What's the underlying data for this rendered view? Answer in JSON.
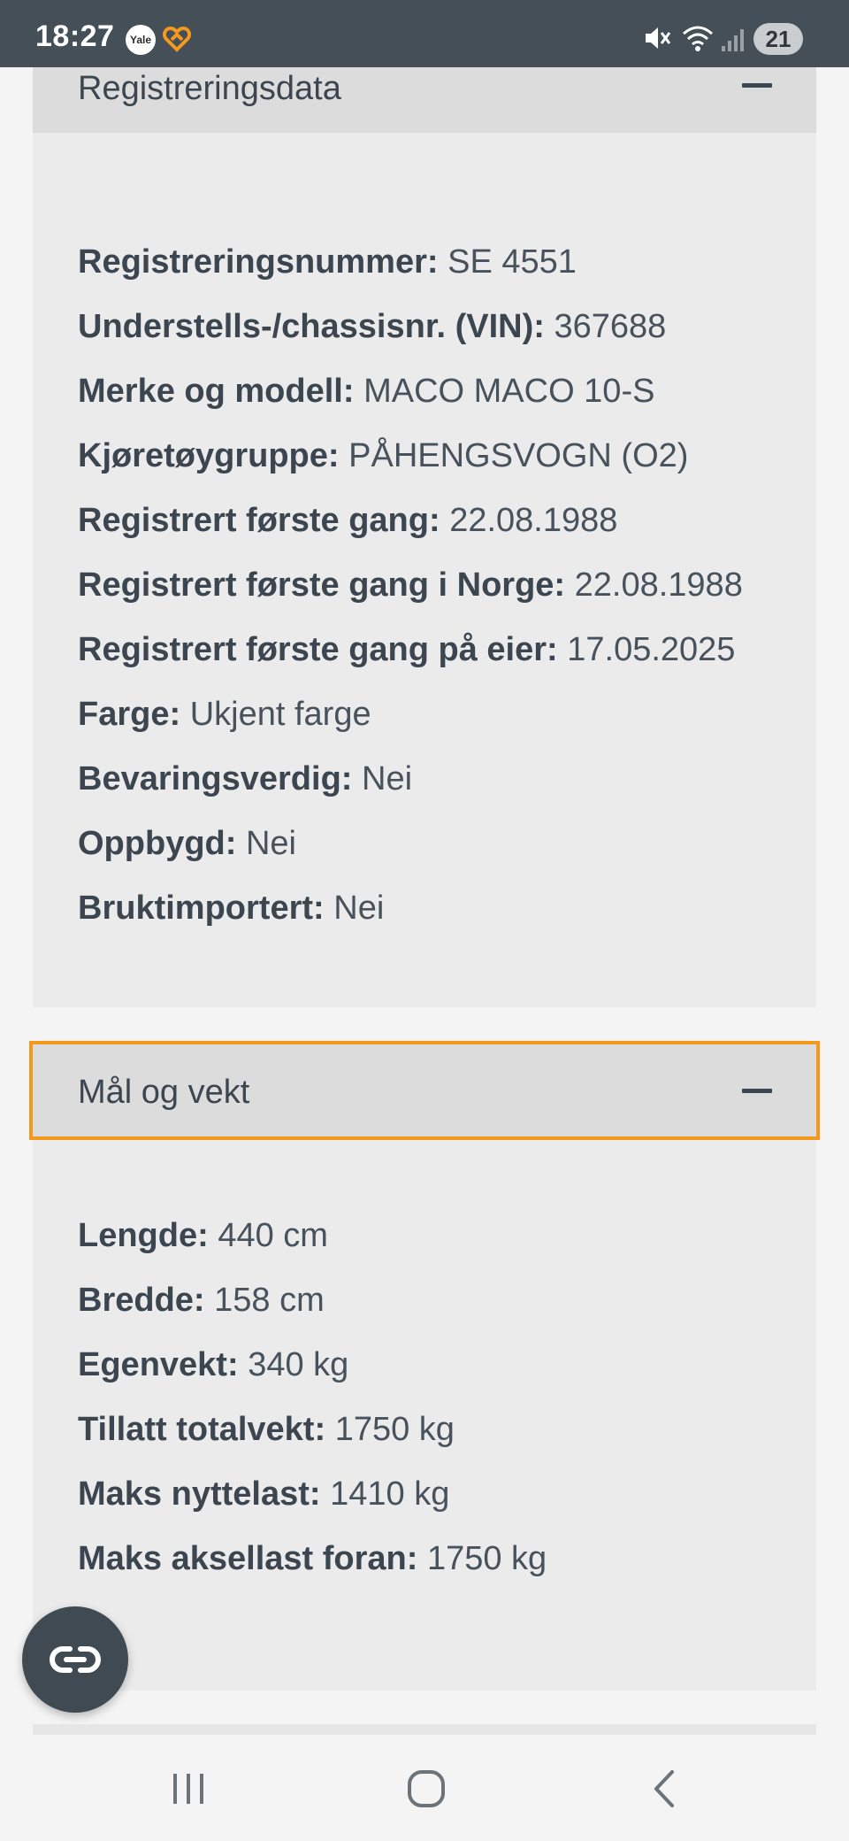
{
  "status_bar": {
    "time": "18:27",
    "yale_badge": "Yale",
    "battery": "21"
  },
  "sections": [
    {
      "title": "Registreringsdata",
      "fields": [
        {
          "label": "Registreringsnummer:",
          "value": "SE 4551"
        },
        {
          "label": "Understells-/chassisnr. (VIN):",
          "value": "367688"
        },
        {
          "label": "Merke og modell:",
          "value": "MACO MACO 10-S"
        },
        {
          "label": "Kjøretøygruppe:",
          "value": "PÅHENGSVOGN (O2)"
        },
        {
          "label": "Registrert første gang:",
          "value": "22.08.1988"
        },
        {
          "label": "Registrert første gang i Norge:",
          "value": "22.08.1988"
        },
        {
          "label": "Registrert første gang på eier:",
          "value": "17.05.2025"
        },
        {
          "label": "Farge:",
          "value": "Ukjent farge"
        },
        {
          "label": "Bevaringsverdig:",
          "value": "Nei"
        },
        {
          "label": "Oppbygd:",
          "value": "Nei"
        },
        {
          "label": "Bruktimportert:",
          "value": "Nei"
        }
      ]
    },
    {
      "title": "Mål og vekt",
      "fields": [
        {
          "label": "Lengde:",
          "value": "440 cm"
        },
        {
          "label": "Bredde:",
          "value": "158 cm"
        },
        {
          "label": "Egenvekt:",
          "value": "340 kg"
        },
        {
          "label": "Tillatt totalvekt:",
          "value": "1750 kg"
        },
        {
          "label": "Maks nyttelast:",
          "value": "1410 kg"
        },
        {
          "label": "Maks aksellast foran:",
          "value": "1750 kg"
        }
      ]
    }
  ],
  "icons": {
    "collapse": "minus-icon",
    "fab": "link-icon",
    "nav": [
      "recent-apps-icon",
      "home-icon",
      "back-icon"
    ]
  },
  "colors": {
    "status_bar": "#444f57",
    "section_bg": "#ebebeb",
    "header_bg": "#dcdcdc",
    "focus_outline": "#f39a1e",
    "text": "#3c4650"
  }
}
